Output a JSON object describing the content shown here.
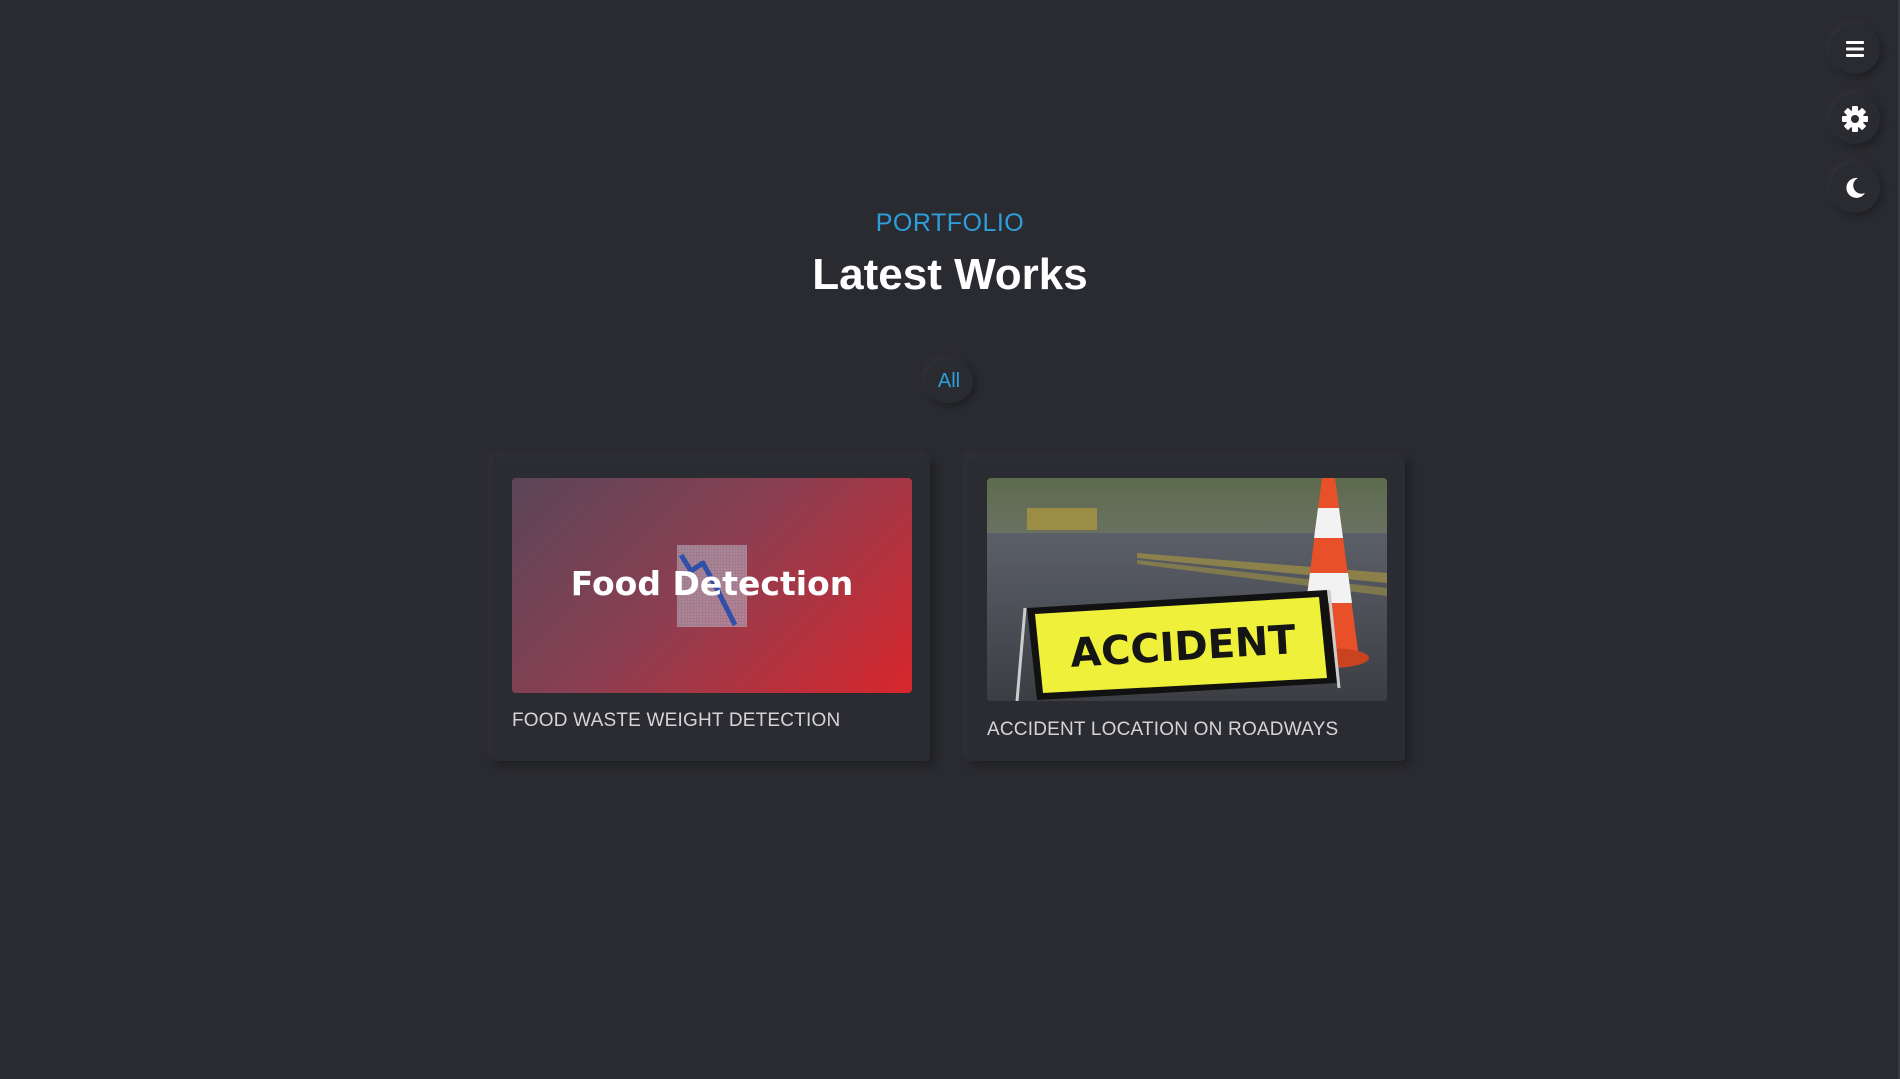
{
  "side_controls": {
    "menu_icon": "menu-icon",
    "settings_icon": "gear-icon",
    "theme_icon": "moon-icon"
  },
  "section": {
    "subtitle": "PORTFOLIO",
    "title": "Latest Works"
  },
  "filters": [
    {
      "label": "All",
      "active": true
    }
  ],
  "projects": [
    {
      "thumbnail_text": "Food Detection",
      "caption": "FOOD WASTE WEIGHT DETECTION"
    },
    {
      "thumbnail_text": "ACCIDENT",
      "caption": "ACCIDENT LOCATION ON ROADWAYS"
    }
  ],
  "colors": {
    "background": "#2a2b30",
    "accent": "#2c9fdb",
    "title": "#ffffff",
    "caption": "#d5d5d8"
  }
}
